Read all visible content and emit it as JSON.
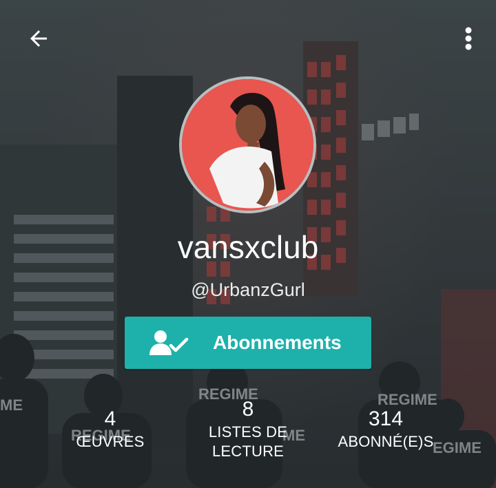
{
  "profile": {
    "display_name": "vansxclub",
    "handle": "@UrbanzGurl",
    "follow_label": "Abonnements"
  },
  "stats": {
    "works": {
      "value": "4",
      "label": "ŒUVRES"
    },
    "reading_lists": {
      "value": "8",
      "label": "LISTES DE LECTURE"
    },
    "followers": {
      "value": "314",
      "label": "ABONNÉ(E)S"
    }
  },
  "background_text": {
    "signs": [
      "REGIME",
      "REGIME",
      "REGIME",
      "ME",
      "ME",
      "EGIME",
      "REGIME"
    ]
  },
  "icons": {
    "back": "arrow-left",
    "menu": "more-vert",
    "follow": "user-check"
  },
  "colors": {
    "accent": "#1eb1ab",
    "avatar_bg": "#e8564f"
  }
}
